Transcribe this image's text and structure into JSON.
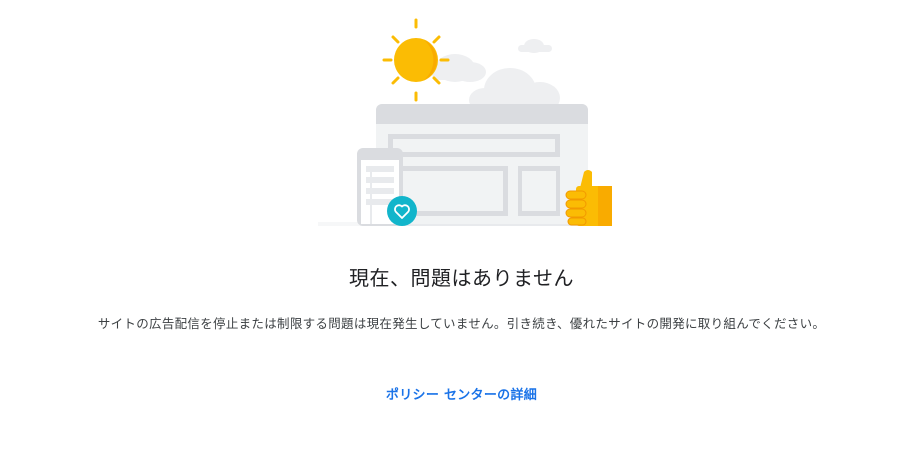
{
  "status": {
    "title": "現在、問題はありません",
    "description": "サイトの広告配信を停止または制限する問題は現在発生していません。引き続き、優れたサイトの開発に取り組んでください。",
    "link_label": "ポリシー センターの詳細"
  },
  "illustration": {
    "icons": [
      "sun-icon",
      "cloud-icon",
      "browser-window-icon",
      "mobile-phone-icon",
      "heart-icon",
      "thumbs-up-icon"
    ]
  },
  "colors": {
    "link": "#1a73e8",
    "sun": "#fbbc04",
    "heart_badge": "#12b5cb",
    "title_text": "#202124"
  }
}
